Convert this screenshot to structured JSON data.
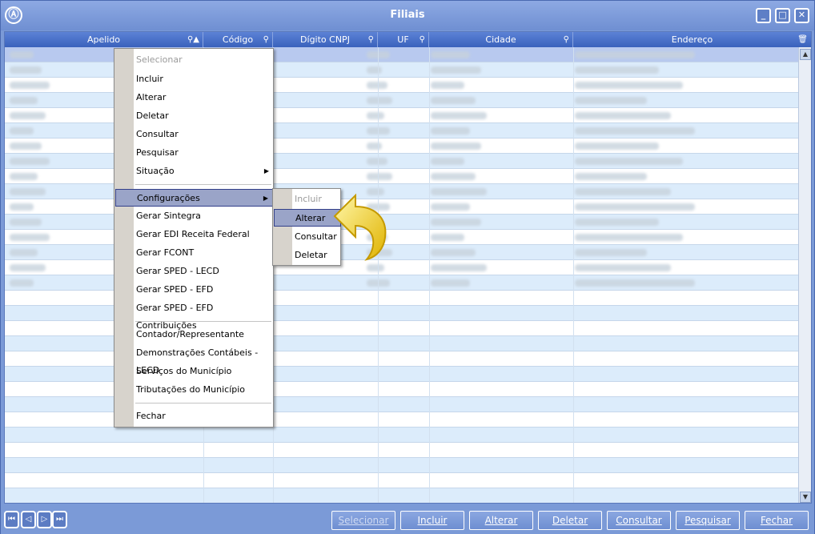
{
  "window": {
    "title": "Filiais",
    "logo": "Ⓐ",
    "controls": [
      "_",
      "□",
      "✕"
    ]
  },
  "columns": [
    "Apelido",
    "Código",
    "Dígito CNPJ",
    "UF",
    "Cidade",
    "Endereço"
  ],
  "context_menu": {
    "items": [
      {
        "label": "Selecionar",
        "disabled": true
      },
      {
        "label": "Incluir"
      },
      {
        "label": "Alterar"
      },
      {
        "label": "Deletar"
      },
      {
        "label": "Consultar"
      },
      {
        "label": "Pesquisar"
      },
      {
        "label": "Situação",
        "submenu": true
      },
      {
        "label": "Configurações",
        "submenu": true,
        "highlighted": true
      },
      {
        "label": "Gerar Sintegra"
      },
      {
        "label": "Gerar EDI Receita Federal"
      },
      {
        "label": "Gerar FCONT"
      },
      {
        "label": "Gerar SPED - LECD"
      },
      {
        "label": "Gerar SPED - EFD"
      },
      {
        "label": "Gerar SPED - EFD Contribuições"
      },
      {
        "label": "Contador/Representante"
      },
      {
        "label": "Demonstrações Contábeis - LECD"
      },
      {
        "label": "Serviços do Município"
      },
      {
        "label": "Tributações do Município"
      },
      {
        "label": "Fechar"
      }
    ]
  },
  "submenu": {
    "items": [
      {
        "label": "Incluir",
        "disabled": true
      },
      {
        "label": "Alterar",
        "highlighted": true
      },
      {
        "label": "Consultar"
      },
      {
        "label": "Deletar"
      }
    ]
  },
  "navigation": {
    "first": "⏮",
    "prev": "◁",
    "next": "▷",
    "last": "⏭"
  },
  "buttons": {
    "selecionar": "Selecionar",
    "incluir": "Incluir",
    "alterar": "Alterar",
    "deletar": "Deletar",
    "consultar": "Consultar",
    "pesquisar": "Pesquisar",
    "fechar": "Fechar"
  },
  "colors": {
    "title_bar": "#7b9ad7",
    "header": "#3a62bc",
    "highlight": "#9aa4c8",
    "arrow": "#f3d225"
  }
}
